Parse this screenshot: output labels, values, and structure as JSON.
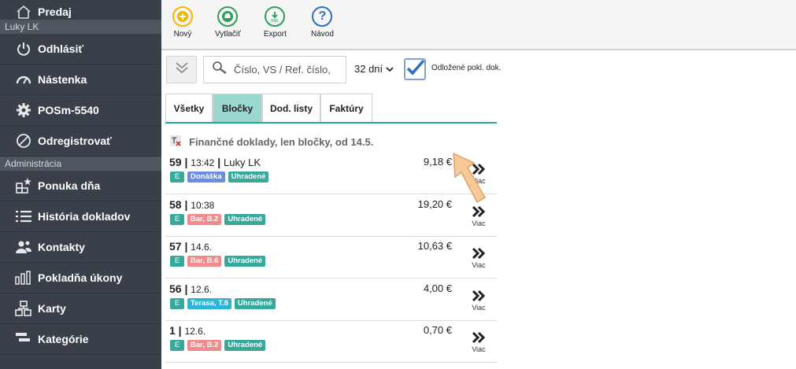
{
  "sidebar": {
    "header": "Predaj",
    "user": "Luky LK",
    "items_top": [
      {
        "label": "Odhlásiť",
        "icon": "power-icon"
      },
      {
        "label": "Nástenka",
        "icon": "tachometer-icon"
      },
      {
        "label": "POSm-5540",
        "icon": "cog-icon"
      },
      {
        "label": "Odregistrovať",
        "icon": "ban-icon"
      }
    ],
    "section_label": "Administrácia",
    "items_admin": [
      {
        "label": "Ponuka dňa",
        "icon": "menu-star-icon"
      },
      {
        "label": "História dokladov",
        "icon": "list-icon"
      },
      {
        "label": "Kontakty",
        "icon": "users-icon"
      },
      {
        "label": "Pokladňa úkony",
        "icon": "columns-icon"
      },
      {
        "label": "Karty",
        "icon": "sitemap-icon"
      },
      {
        "label": "Kategórie",
        "icon": "category-icon"
      }
    ]
  },
  "toolbar": {
    "buttons": [
      {
        "label": "Nový",
        "icon": "plus-circle-icon",
        "color": "#f2b700"
      },
      {
        "label": "Vytlačiť",
        "icon": "print-icon",
        "color": "#2e9e58"
      },
      {
        "label": "Export",
        "icon": "export-xml-icon",
        "color": "#2e9e58"
      },
      {
        "label": "Návod",
        "icon": "help-icon",
        "color": "#2f6fc2"
      }
    ]
  },
  "filters": {
    "search_placeholder": "Číslo, VS / Ref. číslo,",
    "period": "32 dní",
    "checkbox_label": "Odložené pokl. dok.",
    "checkbox_checked": true
  },
  "tabs": [
    {
      "label": "Všetky",
      "active": false
    },
    {
      "label": "Bločky",
      "active": true
    },
    {
      "label": "Dod. listy",
      "active": false
    },
    {
      "label": "Faktúry",
      "active": false
    }
  ],
  "list": {
    "heading": "Finančné doklady, len bločky, od 14.5.",
    "more_label": "Viac",
    "rows": [
      {
        "num": "59",
        "meta": "13:42",
        "user": "Luky LK",
        "amount": "9,18 €",
        "badges": [
          {
            "text": "E",
            "kind": "e"
          },
          {
            "text": "Donáška",
            "kind": "blue"
          },
          {
            "text": "Uhradené",
            "kind": "teal"
          }
        ]
      },
      {
        "num": "58",
        "meta": "10:38",
        "user": "",
        "amount": "19,20 €",
        "badges": [
          {
            "text": "E",
            "kind": "e"
          },
          {
            "text": "Bar, B.2",
            "kind": "red"
          },
          {
            "text": "Uhradené",
            "kind": "teal"
          }
        ]
      },
      {
        "num": "57",
        "meta": "14.6.",
        "user": "",
        "amount": "10,63 €",
        "badges": [
          {
            "text": "E",
            "kind": "e"
          },
          {
            "text": "Bar, B.6",
            "kind": "red"
          },
          {
            "text": "Uhradené",
            "kind": "teal"
          }
        ]
      },
      {
        "num": "56",
        "meta": "12.6.",
        "user": "",
        "amount": "4,00 €",
        "badges": [
          {
            "text": "E",
            "kind": "e"
          },
          {
            "text": "Terasa, T.8",
            "kind": "cyan"
          },
          {
            "text": "Uhradené",
            "kind": "teal"
          }
        ]
      },
      {
        "num": "1",
        "meta": "12.6.",
        "user": "",
        "amount": "0,70 €",
        "badges": [
          {
            "text": "E",
            "kind": "e"
          },
          {
            "text": "Bar, B.2",
            "kind": "red"
          },
          {
            "text": "Uhradené",
            "kind": "teal"
          }
        ]
      }
    ]
  },
  "colors": {
    "accent": "#2aa59b",
    "sidebar_bg": "#3a4049"
  }
}
